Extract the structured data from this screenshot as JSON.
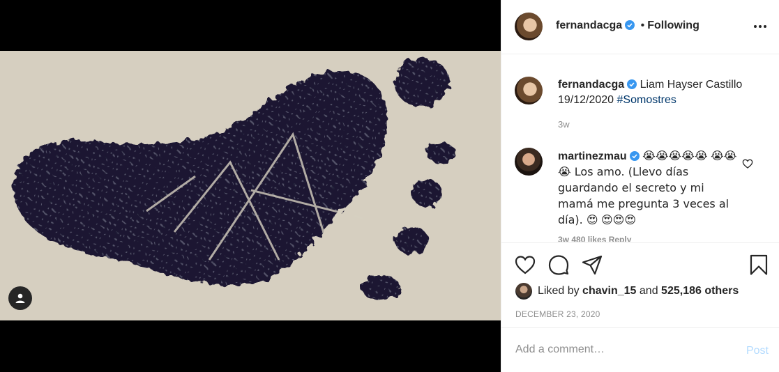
{
  "post": {
    "author": "fernandacga",
    "follow_dot": "•",
    "follow_status": "Following",
    "caption": {
      "username": "fernandacga",
      "text": "Liam Hayser Castillo 19/12/2020",
      "hashtag": "#Somostres",
      "time": "3w"
    },
    "comment": {
      "username": "martinezmau",
      "line1": "😭😭😭😭😭",
      "line2": "😭😭😭 Los amo. (Llevo días guardando el secreto y mi mamá me pregunta 3 veces al día). 😍",
      "line3": "😍😍😍",
      "meta": "3w   480 likes   Reply"
    },
    "likes": {
      "prefix": "Liked by",
      "user": "chavin_15",
      "and": "and",
      "others": "525,186 others"
    },
    "date": "DECEMBER 23, 2020",
    "add_comment": {
      "placeholder": "Add a comment…",
      "post_label": "Post"
    }
  },
  "icons": {
    "verified": "verified-badge-icon",
    "more": "more-options-icon",
    "like": "heart-icon",
    "comment": "comment-icon",
    "share": "share-icon",
    "save": "bookmark-icon",
    "tag": "user-tag-icon"
  },
  "colors": {
    "verified": "#3897f0",
    "link": "#00376b",
    "muted": "#8e8e8e",
    "post_disabled": "#b3dbff"
  }
}
